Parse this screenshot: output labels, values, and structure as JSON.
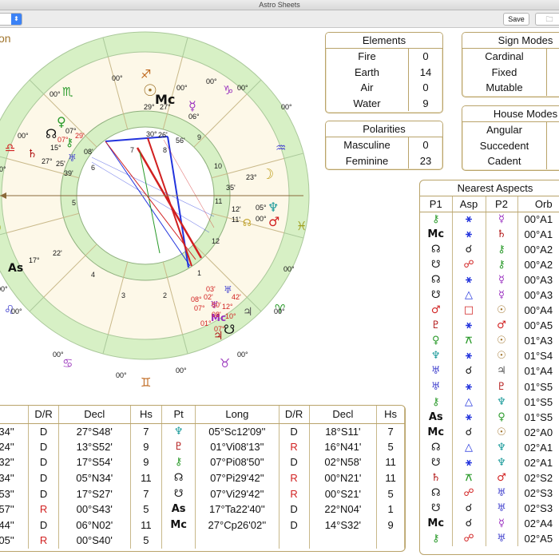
{
  "window": {
    "title": "Astro Sheets",
    "save_label": "Save",
    "chart_name": "on"
  },
  "wheel": {
    "house_numbers": [
      "1",
      "2",
      "3",
      "4",
      "5",
      "6",
      "7",
      "8",
      "9",
      "10",
      "11",
      "12"
    ],
    "labels": [
      {
        "t": "00°",
        "c": "#111"
      },
      {
        "t": "00°",
        "c": "#111"
      },
      {
        "t": "00°",
        "c": "#111"
      },
      {
        "t": "00°",
        "c": "#111"
      },
      {
        "t": "00°",
        "c": "#111"
      },
      {
        "t": "00°",
        "c": "#111"
      },
      {
        "t": "00°",
        "c": "#111"
      },
      {
        "t": "00°",
        "c": "#111"
      },
      {
        "t": "00°",
        "c": "#111"
      },
      {
        "t": "00°",
        "c": "#111"
      },
      {
        "t": "00°",
        "c": "#111"
      },
      {
        "t": "00°",
        "c": "#111"
      },
      {
        "t": "00°",
        "c": "#111"
      },
      {
        "t": "00°",
        "c": "#111"
      },
      {
        "t": "00°",
        "c": "#111"
      },
      {
        "t": "00°",
        "c": "#111"
      },
      {
        "t": "29°",
        "c": "#111"
      },
      {
        "t": "27°",
        "c": "#111"
      },
      {
        "t": "06°",
        "c": "#111"
      },
      {
        "t": "56'",
        "c": "#111"
      },
      {
        "t": "30°",
        "c": "#111"
      },
      {
        "t": "26'",
        "c": "#111"
      },
      {
        "t": "07°",
        "c": "#111"
      },
      {
        "t": "15°",
        "c": "#111"
      },
      {
        "t": "07°",
        "c": "#d12020"
      },
      {
        "t": "29'",
        "c": "#d12020"
      },
      {
        "t": "08'",
        "c": "#111"
      },
      {
        "t": "27°",
        "c": "#111"
      },
      {
        "t": "25'",
        "c": "#111"
      },
      {
        "t": "39'",
        "c": "#111"
      },
      {
        "t": "23°",
        "c": "#111"
      },
      {
        "t": "35'",
        "c": "#111"
      },
      {
        "t": "05°",
        "c": "#111"
      },
      {
        "t": "12'",
        "c": "#111"
      },
      {
        "t": "11'",
        "c": "#111"
      },
      {
        "t": "00°",
        "c": "#111"
      },
      {
        "t": "22'",
        "c": "#111"
      },
      {
        "t": "17°",
        "c": "#111"
      },
      {
        "t": "50'",
        "c": "#d12020"
      },
      {
        "t": "03'",
        "c": "#d12020"
      },
      {
        "t": "02'",
        "c": "#d12020"
      },
      {
        "t": "12°",
        "c": "#d12020"
      },
      {
        "t": "08'",
        "c": "#d12020"
      },
      {
        "t": "08°",
        "c": "#d12020"
      },
      {
        "t": "07°",
        "c": "#d12020"
      },
      {
        "t": "10°",
        "c": "#d12020"
      },
      {
        "t": "42'",
        "c": "#d12020"
      },
      {
        "t": "01°",
        "c": "#d12020"
      },
      {
        "t": "07°",
        "c": "#d12020"
      }
    ],
    "glyphs": [
      "♐",
      "♑",
      "♒",
      "♓",
      "♈",
      "♉",
      "♊",
      "♋",
      "♌",
      "♍",
      "♎",
      "♏",
      "☉",
      "Mc",
      "♀",
      "♄",
      "♃",
      "♅",
      "♆",
      "♂",
      "☽",
      "☿",
      "⚷",
      "☊",
      "☋",
      "As"
    ]
  },
  "elements": {
    "title": "Elements",
    "rows": [
      {
        "label": "Fire",
        "value": "0"
      },
      {
        "label": "Earth",
        "value": "14"
      },
      {
        "label": "Air",
        "value": "0"
      },
      {
        "label": "Water",
        "value": "9"
      }
    ]
  },
  "polarities": {
    "title": "Polarities",
    "rows": [
      {
        "label": "Masculine",
        "value": "0"
      },
      {
        "label": "Feminine",
        "value": "23"
      }
    ]
  },
  "sign_modes": {
    "title": "Sign Modes",
    "rows": [
      {
        "label": "Cardinal"
      },
      {
        "label": "Fixed"
      },
      {
        "label": "Mutable"
      }
    ]
  },
  "house_modes": {
    "title": "House Modes",
    "rows": [
      {
        "label": "Angular"
      },
      {
        "label": "Succedent"
      },
      {
        "label": "Cadent"
      }
    ]
  },
  "positions": {
    "headers": [
      "",
      "D/R",
      "Decl",
      "Hs",
      "Pt",
      "Long",
      "D/R",
      "Decl",
      "Hs"
    ],
    "left": [
      {
        "long": "34''",
        "dr": "D",
        "decl": "27°S48'",
        "hs": "7"
      },
      {
        "long": "24''",
        "dr": "D",
        "decl": "13°S52'",
        "hs": "9"
      },
      {
        "long": "32''",
        "dr": "D",
        "decl": "17°S54'",
        "hs": "9"
      },
      {
        "long": "34''",
        "dr": "D",
        "decl": "05°N34'",
        "hs": "11"
      },
      {
        "long": "53''",
        "dr": "D",
        "decl": "17°S27'",
        "hs": "7"
      },
      {
        "long": "57''",
        "dr": "R",
        "decl": "00°S43'",
        "hs": "5"
      },
      {
        "long": "44''",
        "dr": "D",
        "decl": "06°N02'",
        "hs": "11"
      },
      {
        "long": "05''",
        "dr": "R",
        "decl": "00°S40'",
        "hs": "5"
      }
    ],
    "right": [
      {
        "pt": "♆",
        "color": "#1a9a9a",
        "long": "05°Sc12'09''",
        "dr": "D",
        "decl": "18°S11'",
        "hs": "7"
      },
      {
        "pt": "♇",
        "color": "#b01010",
        "long": "01°Vi08'13''",
        "dr": "R",
        "decl": "16°N41'",
        "hs": "5"
      },
      {
        "pt": "⚷",
        "color": "#2a9a2a",
        "long": "07°Pi08'50''",
        "dr": "D",
        "decl": "02°N58'",
        "hs": "11"
      },
      {
        "pt": "☊",
        "color": "#111",
        "long": "07°Pi29'42''",
        "dr": "R",
        "decl": "00°N21'",
        "hs": "11"
      },
      {
        "pt": "☋",
        "color": "#111",
        "long": "07°Vi29'42''",
        "dr": "R",
        "decl": "00°S21'",
        "hs": "5"
      },
      {
        "pt": "As",
        "color": "#111",
        "long": "17°Ta22'40''",
        "dr": "D",
        "decl": "22°N04'",
        "hs": "1"
      },
      {
        "pt": "Mc",
        "color": "#111",
        "long": "27°Cp26'02''",
        "dr": "D",
        "decl": "14°S32'",
        "hs": "9"
      }
    ]
  },
  "aspects": {
    "title": "Nearest Aspects",
    "headers": [
      "P1",
      "Asp",
      "P2",
      "Orb"
    ],
    "rows": [
      {
        "p1": "⚷",
        "p1c": "#2a9a2a",
        "asp": "⚹",
        "ac": "#2233dd",
        "p2": "☿",
        "p2c": "#9a30c0",
        "orb": "00°A1"
      },
      {
        "p1": "Mc",
        "p1c": "#111",
        "asp": "⚹",
        "ac": "#2233dd",
        "p2": "♄",
        "p2c": "#b01010",
        "orb": "00°A1"
      },
      {
        "p1": "☊",
        "p1c": "#111",
        "asp": "☌",
        "ac": "#111",
        "p2": "⚷",
        "p2c": "#2a9a2a",
        "orb": "00°A2"
      },
      {
        "p1": "☋",
        "p1c": "#111",
        "asp": "☍",
        "ac": "#d12020",
        "p2": "⚷",
        "p2c": "#2a9a2a",
        "orb": "00°A2"
      },
      {
        "p1": "☊",
        "p1c": "#111",
        "asp": "⚹",
        "ac": "#2233dd",
        "p2": "☿",
        "p2c": "#9a30c0",
        "orb": "00°A3"
      },
      {
        "p1": "☋",
        "p1c": "#111",
        "asp": "△",
        "ac": "#2233dd",
        "p2": "☿",
        "p2c": "#9a30c0",
        "orb": "00°A3"
      },
      {
        "p1": "♂",
        "p1c": "#d12020",
        "asp": "□",
        "ac": "#d12020",
        "p2": "☉",
        "p2c": "#a0742c",
        "orb": "00°A4"
      },
      {
        "p1": "♇",
        "p1c": "#b01010",
        "asp": "⚹",
        "ac": "#2233dd",
        "p2": "♂",
        "p2c": "#d12020",
        "orb": "00°A5"
      },
      {
        "p1": "♀",
        "p1c": "#2a9a2a",
        "asp": "⚻",
        "ac": "#2a9a2a",
        "p2": "☉",
        "p2c": "#a0742c",
        "orb": "01°A3"
      },
      {
        "p1": "♆",
        "p1c": "#1a9a9a",
        "asp": "⚹",
        "ac": "#2233dd",
        "p2": "☉",
        "p2c": "#a0742c",
        "orb": "01°S4"
      },
      {
        "p1": "♅",
        "p1c": "#4a4ad0",
        "asp": "☌",
        "ac": "#111",
        "p2": "♃",
        "p2c": "#555",
        "orb": "01°A4"
      },
      {
        "p1": "♅",
        "p1c": "#4a4ad0",
        "asp": "⚹",
        "ac": "#2233dd",
        "p2": "♇",
        "p2c": "#b01010",
        "orb": "01°S5"
      },
      {
        "p1": "⚷",
        "p1c": "#2a9a2a",
        "asp": "△",
        "ac": "#2233dd",
        "p2": "♆",
        "p2c": "#1a9a9a",
        "orb": "01°S5"
      },
      {
        "p1": "As",
        "p1c": "#111",
        "asp": "⚹",
        "ac": "#2233dd",
        "p2": "♀",
        "p2c": "#2a9a2a",
        "orb": "01°S5"
      },
      {
        "p1": "Mc",
        "p1c": "#111",
        "asp": "☌",
        "ac": "#111",
        "p2": "☉",
        "p2c": "#a0742c",
        "orb": "02°A0"
      },
      {
        "p1": "☊",
        "p1c": "#111",
        "asp": "△",
        "ac": "#2233dd",
        "p2": "♆",
        "p2c": "#1a9a9a",
        "orb": "02°A1"
      },
      {
        "p1": "☋",
        "p1c": "#111",
        "asp": "⚹",
        "ac": "#2233dd",
        "p2": "♆",
        "p2c": "#1a9a9a",
        "orb": "02°A1"
      },
      {
        "p1": "♄",
        "p1c": "#b01010",
        "asp": "⚻",
        "ac": "#2a9a2a",
        "p2": "♂",
        "p2c": "#d12020",
        "orb": "02°S2"
      },
      {
        "p1": "☊",
        "p1c": "#111",
        "asp": "☍",
        "ac": "#d12020",
        "p2": "♅",
        "p2c": "#4a4ad0",
        "orb": "02°S3"
      },
      {
        "p1": "☋",
        "p1c": "#111",
        "asp": "☌",
        "ac": "#111",
        "p2": "♅",
        "p2c": "#4a4ad0",
        "orb": "02°S3"
      },
      {
        "p1": "Mc",
        "p1c": "#111",
        "asp": "☌",
        "ac": "#111",
        "p2": "☿",
        "p2c": "#9a30c0",
        "orb": "02°A4"
      },
      {
        "p1": "⚷",
        "p1c": "#2a9a2a",
        "asp": "☍",
        "ac": "#d12020",
        "p2": "♅",
        "p2c": "#4a4ad0",
        "orb": "02°A5"
      }
    ]
  }
}
